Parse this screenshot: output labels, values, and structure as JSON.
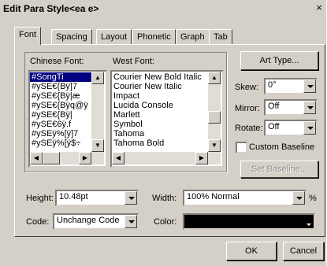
{
  "window": {
    "title": "Edit Para Style<ea e>",
    "close_glyph": "×"
  },
  "tabs": [
    "Font",
    "Spacing",
    "Layout",
    "Phonetic",
    "Graph",
    "Tab"
  ],
  "chinese_font": {
    "label": "Chinese Font:",
    "items": [
      "#SongTi",
      "#ySE€{Bÿ]7",
      "#ySE€{Bÿ|æ",
      "#ySE€{Bÿq@ÿ",
      "#ySE€{Bÿ|",
      "#ySE€6ÿ.f",
      "#ySEÿ%[ÿ]7",
      "#ySEÿ%[ÿ$÷"
    ],
    "selected": "#SongTi"
  },
  "west_font": {
    "label": "West Font:",
    "items": [
      "Courier New Bold Italic",
      "Courier New Italic",
      "Impact",
      "Lucida Console",
      "Marlett",
      "Symbol",
      "Tahoma",
      "Tahoma Bold"
    ]
  },
  "art_type": {
    "label": "Art Type..."
  },
  "skew": {
    "label": "Skew:",
    "value": "0°"
  },
  "mirror": {
    "label": "Mirror:",
    "value": "Off"
  },
  "rotate": {
    "label": "Rotate:",
    "value": "Off"
  },
  "custom_baseline": {
    "label": "Custom Baseline",
    "checked": false
  },
  "set_baseline": {
    "label": "Set Baseline..."
  },
  "height": {
    "label": "Height:",
    "value": "10.48pt"
  },
  "width": {
    "label": "Width:",
    "value": "100% Normal",
    "unit": "%"
  },
  "code": {
    "label": "Code:",
    "value": "Unchange Code"
  },
  "color": {
    "label": "Color:",
    "value": "#000000"
  },
  "buttons": {
    "ok": "OK",
    "cancel": "Cancel"
  }
}
